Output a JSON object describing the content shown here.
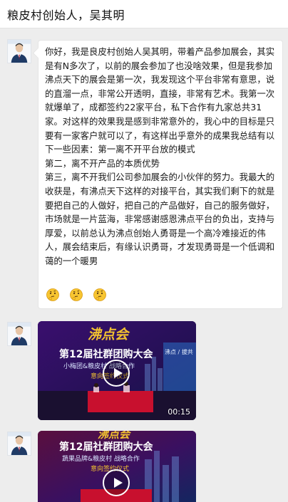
{
  "header": {
    "title": "粮皮村创始人，吴其明"
  },
  "messages": [
    {
      "type": "text",
      "avatar": "user-avatar",
      "text": "你好，我是良皮村创始人吴其明，带着产品参加展会，其实是有N多次了，以前的展会参加了也没啥效果，但是我参加沸点天下的展会是第一次，我发现这个平台非常有意思，说的直溜一点，非常公开透明，直接，非常有艺术。我第一次就爆单了，成都签约22家平台，私下合作有九家总共31家。对这样的效果我是感到非常意外的，我心中的目标是只要有一家客户就可以了，有这样出乎意外的成果我总结有以下一些因素：第一离不开平台放的模式\n第二，离不开产品的本质优势\n第三，离不开我们公司参加展会的小伙伴的努力。我最大的收获是，有沸点天下这样的对接平台，其实我们剩下的就是要把自己的人做好，把自己的产品做好，自己的服务做好，市场就是一片蓝海，非常感谢感恩沸点平台的负出，支持与厚爱，以前总认为沸点创始人勇哥是一个高冷难接近的伟人，展会结束后，有缘认识勇哥，才发现勇哥是一个低调和蔼的一个暖男",
      "emojis": [
        "thinking-face-emoji",
        "thinking-face-emoji",
        "thinking-face-emoji"
      ]
    },
    {
      "type": "video",
      "avatar": "user-avatar",
      "duration": "00:15",
      "thumbnail": {
        "brand": "沸点会",
        "headline": "第12届社群团购大会",
        "subline": "小梅团&粮皮村 战略合作",
        "caption": "意向签约仪式",
        "side_text": "沸点 / 拔共"
      }
    },
    {
      "type": "video",
      "avatar": "user-avatar",
      "thumbnail": {
        "brand": "沸点会",
        "headline": "第12届社群团购大会",
        "subline": "蔬果品牌&粮皮村 战略合作",
        "caption": "意向签约仪式"
      }
    }
  ],
  "colors": {
    "background": "#ededed",
    "bubble": "#ffffff",
    "video_bg": "#1c0a3a",
    "stage_red": "#c8102e",
    "brand_gold": "#f2c230"
  }
}
